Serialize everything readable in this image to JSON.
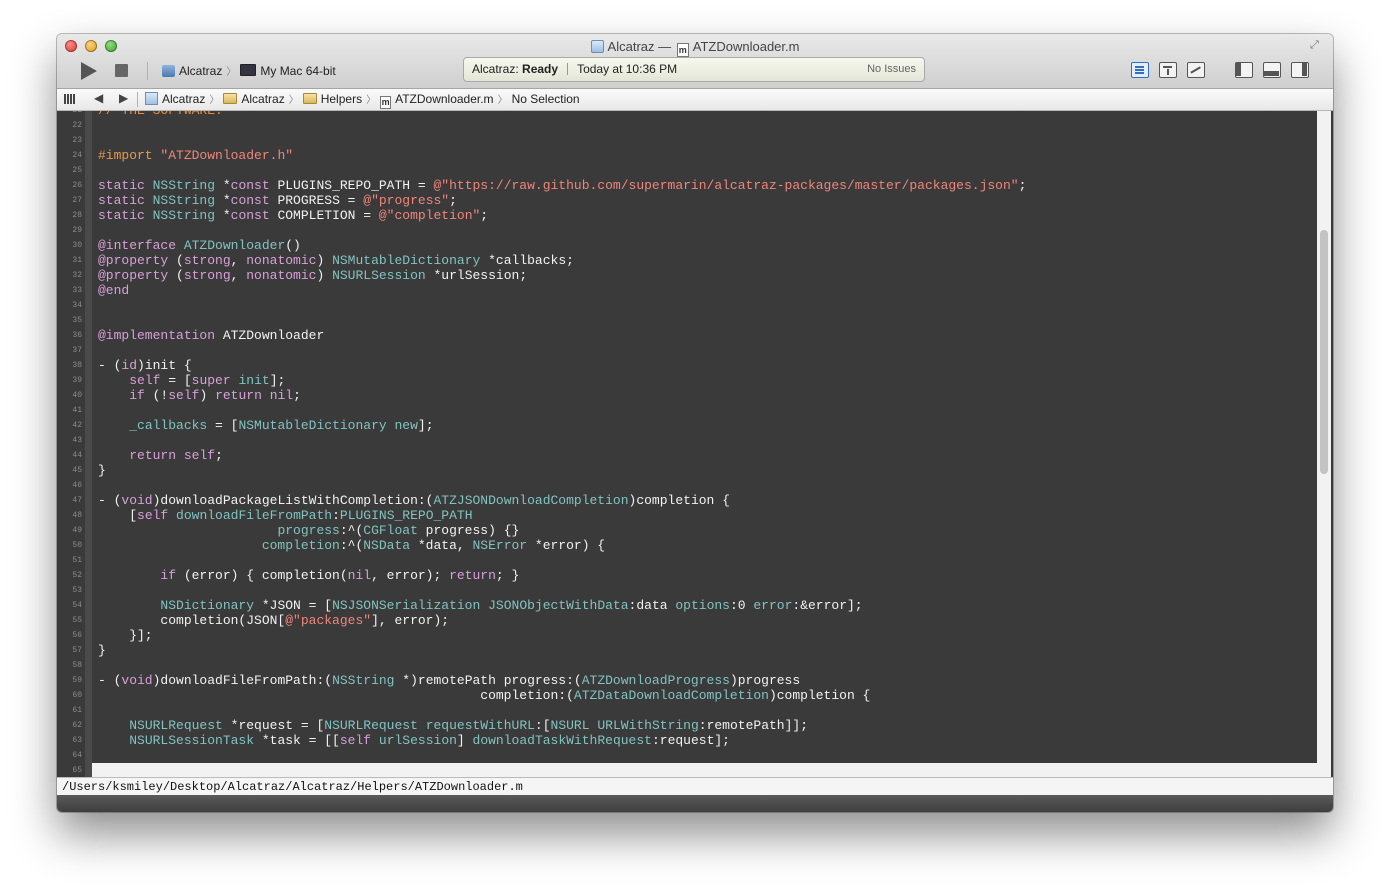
{
  "window": {
    "project_title": "Alcatraz",
    "title_sep": "—",
    "file_title": "ATZDownloader.m"
  },
  "toolbar": {
    "scheme": "Alcatraz",
    "destination": "My Mac 64-bit",
    "activity_project": "Alcatraz:",
    "activity_status": "Ready",
    "activity_time": "Today at 10:36 PM",
    "activity_issues": "No Issues"
  },
  "jumpbar": {
    "crumbs": [
      "Alcatraz",
      "Alcatraz",
      "Helpers",
      "ATZDownloader.m",
      "No Selection"
    ]
  },
  "editor": {
    "lines": [
      {
        "n": "21",
        "t": [
          [
            "cm",
            "// THE SOFTWARE."
          ]
        ]
      },
      {
        "n": "22",
        "t": []
      },
      {
        "n": "23",
        "t": []
      },
      {
        "n": "24",
        "t": [
          [
            "pp",
            "#import "
          ],
          [
            "st",
            "\"ATZDownloader.h\""
          ]
        ]
      },
      {
        "n": "25",
        "t": []
      },
      {
        "n": "26",
        "t": [
          [
            "kw",
            "static "
          ],
          [
            "ty",
            "NSString"
          ],
          [
            "pl",
            " *"
          ],
          [
            "kw",
            "const"
          ],
          [
            "pl",
            " PLUGINS_REPO_PATH = "
          ],
          [
            "st",
            "@\"https://raw.github.com/supermarin/alcatraz-packages/master/packages.json\""
          ],
          [
            "pl",
            ";"
          ]
        ]
      },
      {
        "n": "27",
        "t": [
          [
            "kw",
            "static "
          ],
          [
            "ty",
            "NSString"
          ],
          [
            "pl",
            " *"
          ],
          [
            "kw",
            "const"
          ],
          [
            "pl",
            " PROGRESS = "
          ],
          [
            "st",
            "@\"progress\""
          ],
          [
            "pl",
            ";"
          ]
        ]
      },
      {
        "n": "28",
        "t": [
          [
            "kw",
            "static "
          ],
          [
            "ty",
            "NSString"
          ],
          [
            "pl",
            " *"
          ],
          [
            "kw",
            "const"
          ],
          [
            "pl",
            " COMPLETION = "
          ],
          [
            "st",
            "@\"completion\""
          ],
          [
            "pl",
            ";"
          ]
        ]
      },
      {
        "n": "29",
        "t": []
      },
      {
        "n": "30",
        "t": [
          [
            "kw",
            "@interface "
          ],
          [
            "ty",
            "ATZDownloader"
          ],
          [
            "pl",
            "()"
          ]
        ]
      },
      {
        "n": "31",
        "t": [
          [
            "kw",
            "@property "
          ],
          [
            "pl",
            "("
          ],
          [
            "kw",
            "strong"
          ],
          [
            "pl",
            ", "
          ],
          [
            "kw",
            "nonatomic"
          ],
          [
            "pl",
            ") "
          ],
          [
            "ty",
            "NSMutableDictionary"
          ],
          [
            "pl",
            " *callbacks;"
          ]
        ]
      },
      {
        "n": "32",
        "t": [
          [
            "kw",
            "@property "
          ],
          [
            "pl",
            "("
          ],
          [
            "kw",
            "strong"
          ],
          [
            "pl",
            ", "
          ],
          [
            "kw",
            "nonatomic"
          ],
          [
            "pl",
            ") "
          ],
          [
            "ty",
            "NSURLSession"
          ],
          [
            "pl",
            " *urlSession;"
          ]
        ]
      },
      {
        "n": "33",
        "t": [
          [
            "kw",
            "@end"
          ]
        ]
      },
      {
        "n": "34",
        "t": []
      },
      {
        "n": "35",
        "t": []
      },
      {
        "n": "36",
        "t": [
          [
            "kw",
            "@implementation "
          ],
          [
            "pl",
            "ATZDownloader"
          ]
        ]
      },
      {
        "n": "37",
        "t": []
      },
      {
        "n": "38",
        "t": [
          [
            "pl",
            "- ("
          ],
          [
            "kw",
            "id"
          ],
          [
            "pl",
            ")init {"
          ]
        ]
      },
      {
        "n": "39",
        "t": [
          [
            "pl",
            "    "
          ],
          [
            "kw",
            "self"
          ],
          [
            "pl",
            " = ["
          ],
          [
            "kw",
            "super"
          ],
          [
            "pl",
            " "
          ],
          [
            "ty",
            "init"
          ],
          [
            "pl",
            "];"
          ]
        ]
      },
      {
        "n": "40",
        "t": [
          [
            "pl",
            "    "
          ],
          [
            "kw",
            "if"
          ],
          [
            "pl",
            " (!"
          ],
          [
            "kw",
            "self"
          ],
          [
            "pl",
            ") "
          ],
          [
            "kw",
            "return"
          ],
          [
            "pl",
            " "
          ],
          [
            "kw",
            "nil"
          ],
          [
            "pl",
            ";"
          ]
        ]
      },
      {
        "n": "41",
        "t": []
      },
      {
        "n": "42",
        "t": [
          [
            "pl",
            "    "
          ],
          [
            "ty",
            "_callbacks"
          ],
          [
            "pl",
            " = ["
          ],
          [
            "ty",
            "NSMutableDictionary"
          ],
          [
            "pl",
            " "
          ],
          [
            "ty",
            "new"
          ],
          [
            "pl",
            "];"
          ]
        ]
      },
      {
        "n": "43",
        "t": []
      },
      {
        "n": "44",
        "t": [
          [
            "pl",
            "    "
          ],
          [
            "kw",
            "return"
          ],
          [
            "pl",
            " "
          ],
          [
            "kw",
            "self"
          ],
          [
            "pl",
            ";"
          ]
        ]
      },
      {
        "n": "45",
        "t": [
          [
            "pl",
            "}"
          ]
        ]
      },
      {
        "n": "46",
        "t": []
      },
      {
        "n": "47",
        "t": [
          [
            "pl",
            "- ("
          ],
          [
            "kw",
            "void"
          ],
          [
            "pl",
            ")downloadPackageListWithCompletion:("
          ],
          [
            "ty",
            "ATZJSONDownloadCompletion"
          ],
          [
            "pl",
            ")completion {"
          ]
        ]
      },
      {
        "n": "48",
        "t": [
          [
            "pl",
            "    ["
          ],
          [
            "kw",
            "self"
          ],
          [
            "pl",
            " "
          ],
          [
            "ty",
            "downloadFileFromPath"
          ],
          [
            "pl",
            ":"
          ],
          [
            "ty",
            "PLUGINS_REPO_PATH"
          ]
        ]
      },
      {
        "n": "49",
        "t": [
          [
            "pl",
            "                       "
          ],
          [
            "ty",
            "progress"
          ],
          [
            "pl",
            ":^("
          ],
          [
            "ty",
            "CGFloat"
          ],
          [
            "pl",
            " progress) {}"
          ]
        ]
      },
      {
        "n": "50",
        "t": [
          [
            "pl",
            "                     "
          ],
          [
            "ty",
            "completion"
          ],
          [
            "pl",
            ":^("
          ],
          [
            "ty",
            "NSData"
          ],
          [
            "pl",
            " *data, "
          ],
          [
            "ty",
            "NSError"
          ],
          [
            "pl",
            " *error) {"
          ]
        ]
      },
      {
        "n": "51",
        "t": []
      },
      {
        "n": "52",
        "t": [
          [
            "pl",
            "        "
          ],
          [
            "kw",
            "if"
          ],
          [
            "pl",
            " (error) { completion("
          ],
          [
            "kw",
            "nil"
          ],
          [
            "pl",
            ", error); "
          ],
          [
            "kw",
            "return"
          ],
          [
            "pl",
            "; }"
          ]
        ]
      },
      {
        "n": "53",
        "t": []
      },
      {
        "n": "54",
        "t": [
          [
            "pl",
            "        "
          ],
          [
            "ty",
            "NSDictionary"
          ],
          [
            "pl",
            " *JSON = ["
          ],
          [
            "ty",
            "NSJSONSerialization"
          ],
          [
            "pl",
            " "
          ],
          [
            "ty",
            "JSONObjectWithData"
          ],
          [
            "pl",
            ":data "
          ],
          [
            "ty",
            "options"
          ],
          [
            "pl",
            ":0 "
          ],
          [
            "ty",
            "error"
          ],
          [
            "pl",
            ":&error];"
          ]
        ]
      },
      {
        "n": "55",
        "t": [
          [
            "pl",
            "        completion(JSON["
          ],
          [
            "st",
            "@\"packages\""
          ],
          [
            "pl",
            "], error);"
          ]
        ]
      },
      {
        "n": "56",
        "t": [
          [
            "pl",
            "    }];"
          ]
        ]
      },
      {
        "n": "57",
        "t": [
          [
            "pl",
            "}"
          ]
        ]
      },
      {
        "n": "58",
        "t": []
      },
      {
        "n": "59",
        "t": [
          [
            "pl",
            "- ("
          ],
          [
            "kw",
            "void"
          ],
          [
            "pl",
            ")downloadFileFromPath:("
          ],
          [
            "ty",
            "NSString"
          ],
          [
            "pl",
            " *)remotePath progress:("
          ],
          [
            "ty",
            "ATZDownloadProgress"
          ],
          [
            "pl",
            ")progress"
          ]
        ]
      },
      {
        "n": "60",
        "t": [
          [
            "pl",
            "                                                 completion:("
          ],
          [
            "ty",
            "ATZDataDownloadCompletion"
          ],
          [
            "pl",
            ")completion {"
          ]
        ]
      },
      {
        "n": "61",
        "t": []
      },
      {
        "n": "62",
        "t": [
          [
            "pl",
            "    "
          ],
          [
            "ty",
            "NSURLRequest"
          ],
          [
            "pl",
            " *request = ["
          ],
          [
            "ty",
            "NSURLRequest"
          ],
          [
            "pl",
            " "
          ],
          [
            "ty",
            "requestWithURL"
          ],
          [
            "pl",
            ":["
          ],
          [
            "ty",
            "NSURL"
          ],
          [
            "pl",
            " "
          ],
          [
            "ty",
            "URLWithString"
          ],
          [
            "pl",
            ":remotePath]];"
          ]
        ]
      },
      {
        "n": "63",
        "t": [
          [
            "pl",
            "    "
          ],
          [
            "ty",
            "NSURLSessionTask"
          ],
          [
            "pl",
            " *task = [["
          ],
          [
            "kw",
            "self"
          ],
          [
            "pl",
            " "
          ],
          [
            "ty",
            "urlSession"
          ],
          [
            "pl",
            "] "
          ],
          [
            "ty",
            "downloadTaskWithRequest"
          ],
          [
            "pl",
            ":request];"
          ]
        ]
      },
      {
        "n": "64",
        "t": []
      },
      {
        "n": "65",
        "t": []
      }
    ]
  },
  "statusbar": {
    "path": "/Users/ksmiley/Desktop/Alcatraz/Alcatraz/Helpers/ATZDownloader.m"
  }
}
